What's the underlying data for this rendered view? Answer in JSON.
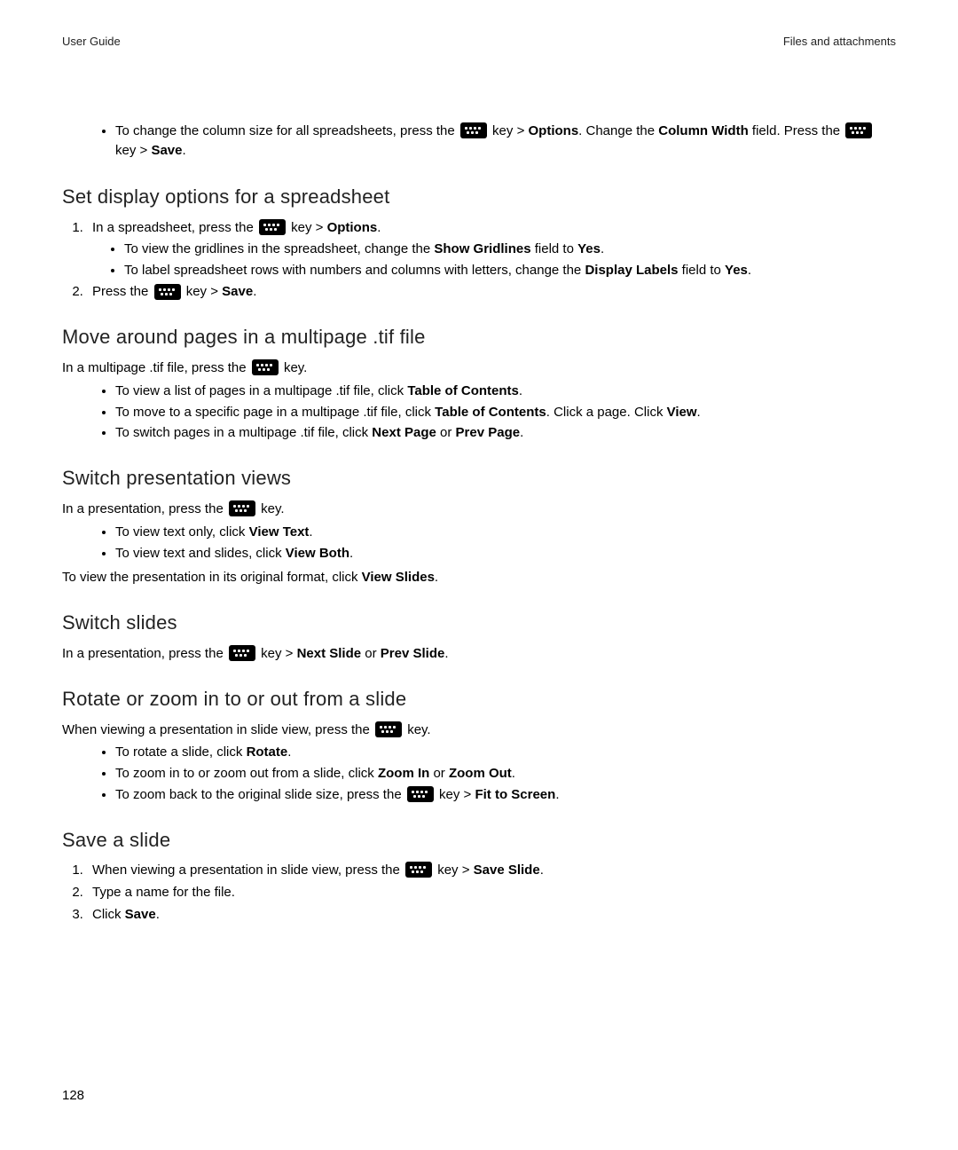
{
  "header": {
    "left": "User Guide",
    "right": "Files and attachments"
  },
  "intro_bullet": {
    "t1": "To change the column size for all spreadsheets, press the ",
    "t2": " key > ",
    "b1": "Options",
    "t3": ". Change the ",
    "b2": "Column Width",
    "t4": " field. Press the ",
    "t5": " key > ",
    "b3": "Save",
    "t6": "."
  },
  "sec1": {
    "title": "Set display options for a spreadsheet",
    "step1": {
      "t1": "In a spreadsheet, press the ",
      "t2": " key > ",
      "b1": "Options",
      "t3": "."
    },
    "b1": {
      "t1": "To view the gridlines in the spreadsheet, change the ",
      "b1": "Show Gridlines",
      "t2": " field to ",
      "b2": "Yes",
      "t3": "."
    },
    "b2": {
      "t1": "To label spreadsheet rows with numbers and columns with letters, change the ",
      "b1": "Display Labels",
      "t2": " field to ",
      "b2": "Yes",
      "t3": "."
    },
    "step2": {
      "t1": "Press the ",
      "t2": " key > ",
      "b1": "Save",
      "t3": "."
    }
  },
  "sec2": {
    "title": "Move around pages in a multipage .tif file",
    "intro": {
      "t1": "In a multipage .tif file, press the ",
      "t2": " key."
    },
    "b1": {
      "t1": "To view a list of pages in a multipage .tif file, click ",
      "b1": "Table of Contents",
      "t2": "."
    },
    "b2": {
      "t1": "To move to a specific page in a multipage .tif file, click ",
      "b1": "Table of Contents",
      "t2": ". Click a page. Click ",
      "b2": "View",
      "t3": "."
    },
    "b3": {
      "t1": "To switch pages in a multipage .tif file, click ",
      "b1": "Next Page",
      "t2": " or ",
      "b2": "Prev Page",
      "t3": "."
    }
  },
  "sec3": {
    "title": "Switch presentation views",
    "intro": {
      "t1": "In a presentation, press the ",
      "t2": " key."
    },
    "b1": {
      "t1": "To view text only, click ",
      "b1": "View Text",
      "t2": "."
    },
    "b2": {
      "t1": "To view text and slides, click ",
      "b1": "View Both",
      "t2": "."
    },
    "outro": {
      "t1": "To view the presentation in its original format, click ",
      "b1": "View Slides",
      "t2": "."
    }
  },
  "sec4": {
    "title": "Switch slides",
    "p": {
      "t1": "In a presentation, press the ",
      "t2": " key > ",
      "b1": "Next Slide",
      "t3": " or ",
      "b2": "Prev Slide",
      "t4": "."
    }
  },
  "sec5": {
    "title": "Rotate or zoom in to or out from a slide",
    "intro": {
      "t1": "When viewing a presentation in slide view, press the ",
      "t2": " key."
    },
    "b1": {
      "t1": "To rotate a slide, click ",
      "b1": "Rotate",
      "t2": "."
    },
    "b2": {
      "t1": "To zoom in to or zoom out from a slide, click ",
      "b1": "Zoom In",
      "t2": " or ",
      "b2": "Zoom Out",
      "t3": "."
    },
    "b3": {
      "t1": "To zoom back to the original slide size, press the ",
      "t2": " key > ",
      "b1": "Fit to Screen",
      "t3": "."
    }
  },
  "sec6": {
    "title": "Save a slide",
    "s1": {
      "t1": "When viewing a presentation in slide view, press the ",
      "t2": " key > ",
      "b1": "Save Slide",
      "t3": "."
    },
    "s2": "Type a name for the file.",
    "s3": {
      "t1": "Click ",
      "b1": "Save",
      "t2": "."
    }
  },
  "page_number": "128"
}
